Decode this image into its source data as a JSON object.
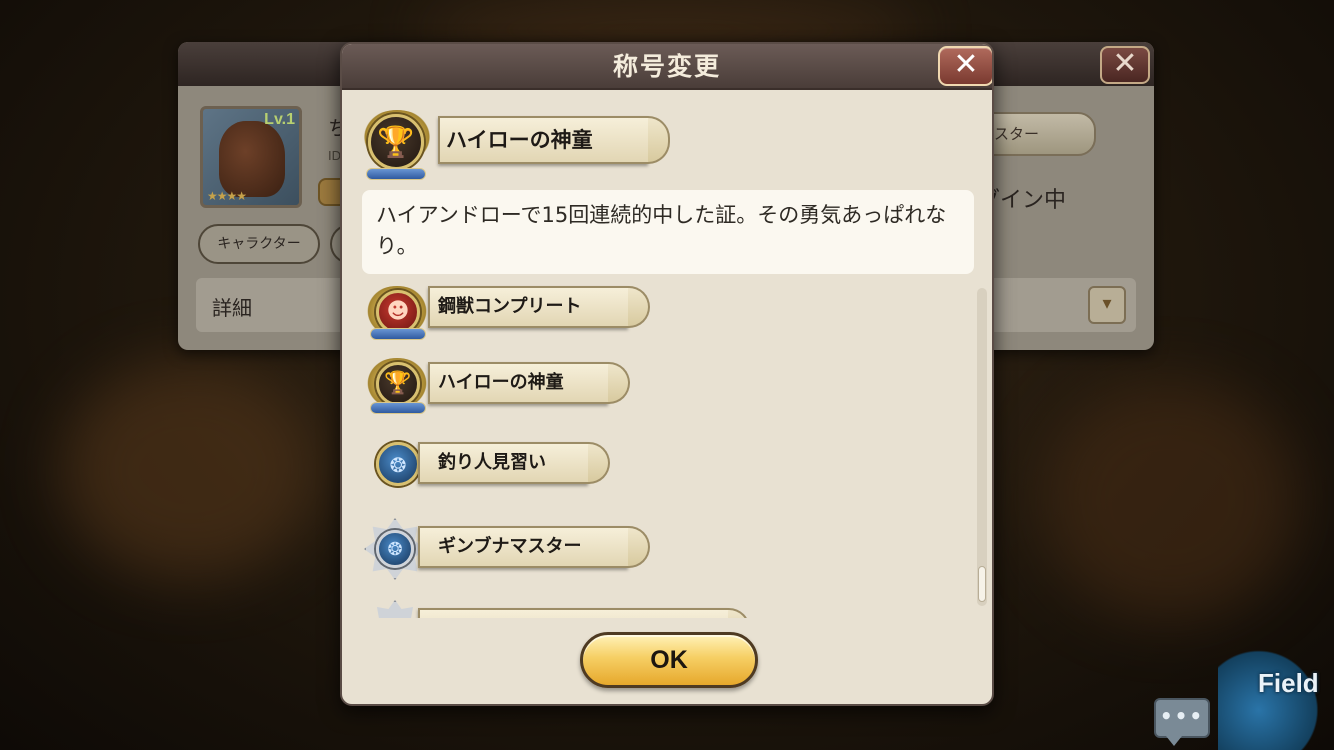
{
  "dialog": {
    "title": "称号変更",
    "close_glyph": "✕",
    "selected": {
      "label": "ハイローの神童",
      "description": "ハイアンドローで15回連続的中した証。その勇気あっぱれなり。"
    },
    "items": [
      {
        "label": "鋼獣コンプリート",
        "badge": "red-demon-icon"
      },
      {
        "label": "ハイローの神童",
        "badge": "gold-trophy-icon"
      },
      {
        "label": "釣り人見習い",
        "badge": "blue-fish-icon"
      },
      {
        "label": "ギンブナマスター",
        "badge": "silver-fish-icon"
      },
      {
        "label": "",
        "badge": "silver-star-icon"
      }
    ],
    "ok_label": "OK"
  },
  "background_panel": {
    "close_glyph": "✕",
    "level_text": "Lv.1",
    "stars": "★★★★",
    "name_fragment": "ち",
    "id_fragment": "ID",
    "character_button": "キャラクター",
    "detail_label": "詳細",
    "dropdown_glyph": "▾",
    "title_badge_fragment": "スター",
    "status_fragment": "グイン中"
  },
  "hud": {
    "chat_dots": "•••",
    "field_label": "Field"
  },
  "colors": {
    "dialog_bg": "#e8e1d2",
    "header_bg": "#4a3d39",
    "ok_button": "#f6cf64",
    "close_button": "#7a3a30"
  }
}
